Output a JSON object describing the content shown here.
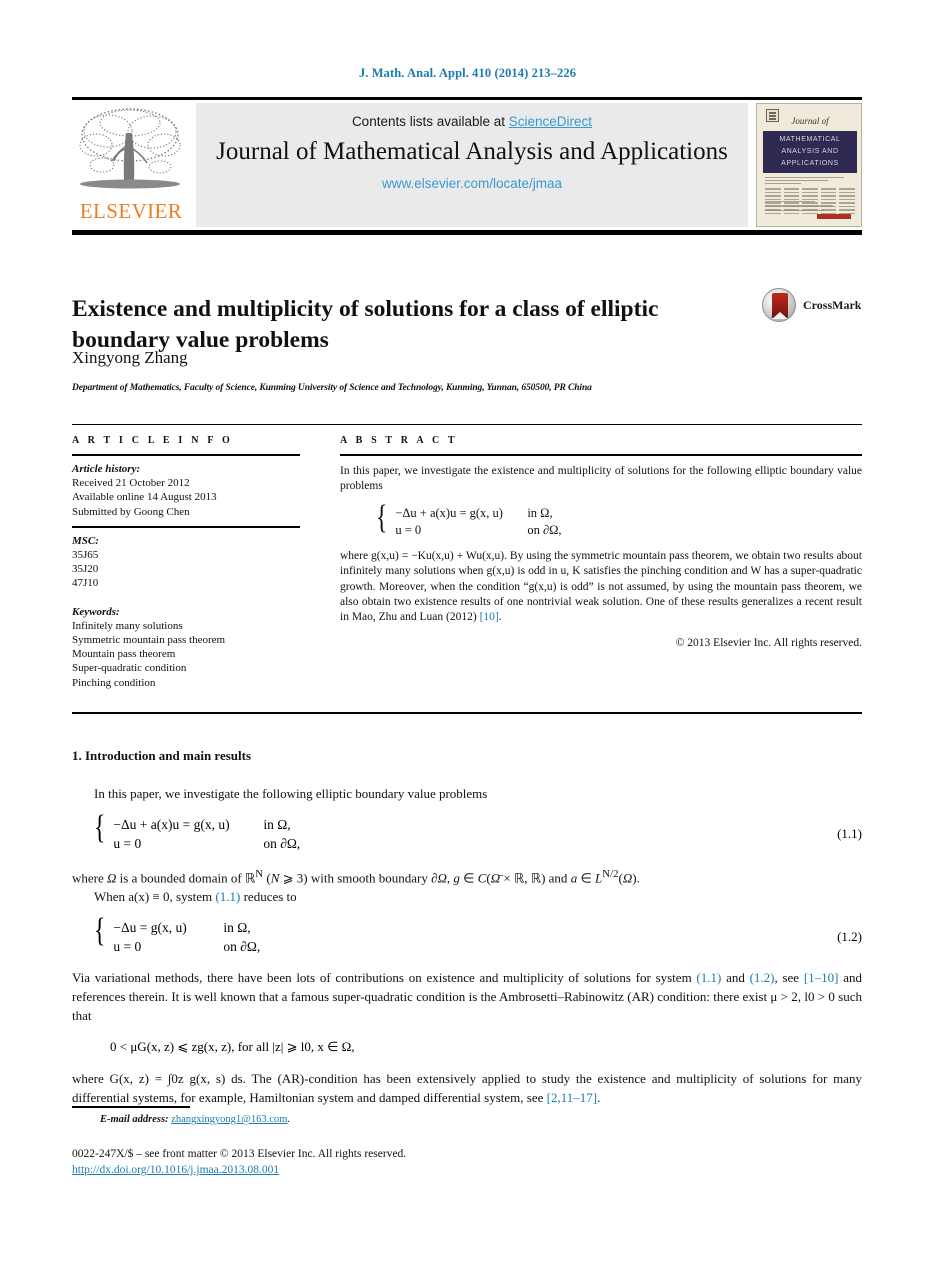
{
  "running_head": "J. Math. Anal. Appl. 410 (2014) 213–226",
  "masthead": {
    "contents_prefix": "Contents lists available at ",
    "sciencedirect": "ScienceDirect",
    "journal_title": "Journal of Mathematical Analysis and Applications",
    "journal_url": "www.elsevier.com/locate/jmaa",
    "publisher_wordmark": "ELSEVIER",
    "cover_script": "Journal of",
    "cover_band_text": "MATHEMATICAL ANALYSIS AND APPLICATIONS",
    "accent_link_color": "#3a9ad0",
    "wordmark_color": "#ef7d22",
    "panel_bg": "#eaeaea"
  },
  "article": {
    "title": "Existence and multiplicity of solutions for a class of elliptic boundary value problems",
    "author": "Xingyong Zhang",
    "affiliation": "Department of Mathematics, Faculty of Science, Kunming University of Science and Technology, Kunming, Yunnan, 650500, PR China",
    "crossmark_label": "CrossMark"
  },
  "info": {
    "heading": "A R T I C L E   I N F O",
    "history_label": "Article history:",
    "history": [
      "Received 21 October 2012",
      "Available online 14 August 2013",
      "Submitted by Goong Chen"
    ],
    "msc_label": "MSC:",
    "msc": [
      "35J65",
      "35J20",
      "47J10"
    ],
    "keywords_label": "Keywords:",
    "keywords": [
      "Infinitely many solutions",
      "Symmetric mountain pass theorem",
      "Mountain pass theorem",
      "Super-quadratic condition",
      "Pinching condition"
    ]
  },
  "abstract": {
    "heading": "A B S T R A C T",
    "p1": "In this paper, we investigate the existence and multiplicity of solutions for the following elliptic boundary value problems",
    "equation": {
      "row1_lhs": "−Δu + a(x)u = g(x, u)",
      "row1_cond": "in Ω,",
      "row2_lhs": "u = 0",
      "row2_cond": "on ∂Ω,"
    },
    "p2_a": "where g(x, u) = − K",
    "p2_full_prefix": "where g(x,u) = −K",
    "p2": "where g(x,u) = −Ku(x,u) + Wu(x,u). By using the symmetric mountain pass theorem, we obtain two results about infinitely many solutions when g(x,u) is odd in u, K satisfies the pinching condition and W has a super-quadratic growth. Moreover, when the condition “g(x,u) is odd” is not assumed, by using the mountain pass theorem, we also obtain two existence results of one nontrivial weak solution. One of these results generalizes a recent result in Mao, Zhu and Luan (2012) ",
    "p2_cite": "[10]",
    "p2_tail": ".",
    "copyright": "© 2013 Elsevier Inc. All rights reserved."
  },
  "body": {
    "section_heading": "1. Introduction and main results",
    "p1": "In this paper, we investigate the following elliptic boundary value problems",
    "eq11": {
      "row1_lhs": "−Δu + a(x)u = g(x, u)",
      "row1_cond": "in Ω,",
      "row2_lhs": "u = 0",
      "row2_cond": "on ∂Ω,",
      "number": "(1.1)"
    },
    "p2_pre": "where Ω is a bounded domain of ℝ",
    "p2": "where Ω is a bounded domain of ℝN (N ⩾ 3) with smooth boundary ∂Ω, g ∈ C(Ω̄ × ℝ, ℝ) and a ∈ LN/2(Ω).",
    "p3_pre": "When a(x) ≡ 0, system ",
    "p3_cite": "(1.1)",
    "p3_post": " reduces to",
    "eq12": {
      "row1_lhs": "−Δu = g(x, u)",
      "row1_cond": "in Ω,",
      "row2_lhs": "u = 0",
      "row2_cond": "on ∂Ω,",
      "number": "(1.2)"
    },
    "p4_a": "Via variational methods, there have been lots of contributions on existence and multiplicity of solutions for system ",
    "p4_cite1": "(1.1)",
    "p4_b": " and ",
    "p4_cite2": "(1.2)",
    "p4_c": ", see ",
    "p4_cite3": "[1–10]",
    "p4_d": " and references therein. It is well known that a famous super-quadratic condition is the Ambrosetti–Rabinowitz (AR) condition: there exist μ > 2, l0 > 0 such that",
    "eq_ar": "0 < μG(x, z) ⩽ zg(x, z),    for all |z| ⩾ l0, x ∈ Ω,",
    "p5_a": "where G(x, z) = ∫0z g(x, s) ds. The (AR)-condition has been extensively applied to study the existence and multiplicity of solutions for many differential systems, for example, Hamiltonian system and damped differential system, see ",
    "p5_cite": "[2,11–17]",
    "p5_b": "."
  },
  "footer": {
    "email_label": "E-mail address:",
    "email": "zhangxingyong1@163.com",
    "email_tail": ".",
    "imprint": "0022-247X/$ – see front matter © 2013 Elsevier Inc. All rights reserved.",
    "doi": "http://dx.doi.org/10.1016/j.jmaa.2013.08.001",
    "link_color": "#1a7cb0"
  }
}
